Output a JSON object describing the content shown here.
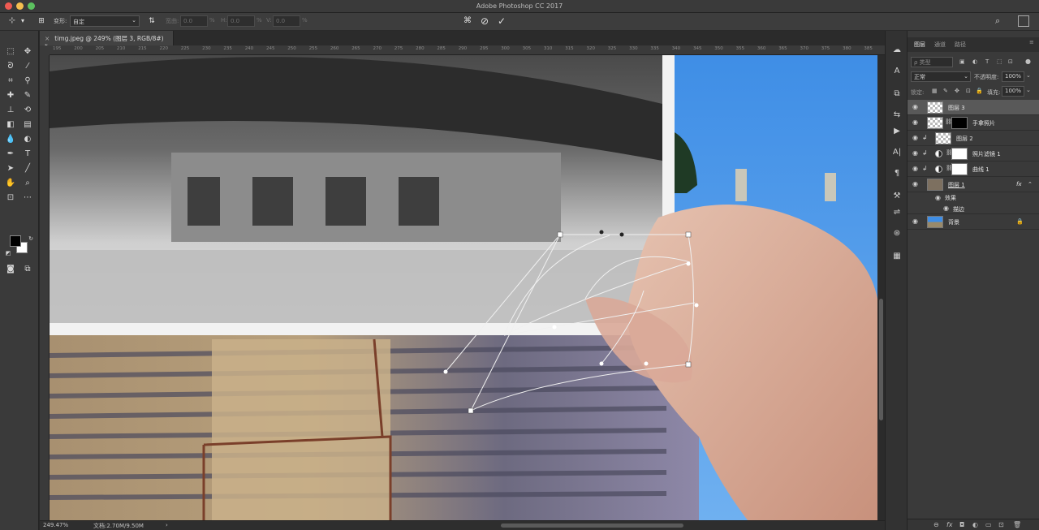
{
  "window": {
    "title": "Adobe Photoshop CC 2017"
  },
  "options": {
    "transform_label": "变形:",
    "transform_value": "自定",
    "w_label": "宽曲:",
    "w_value": "0.0",
    "h_label": "H:",
    "h_value": "0.0",
    "v_label": "V:",
    "v_value": "0.0",
    "percent": "%"
  },
  "document": {
    "tab_label": "timg.jpeg @ 249% (图层 3, RGB/8#) *",
    "ruler_ticks": [
      "195",
      "200",
      "205",
      "210",
      "215",
      "220",
      "225",
      "230",
      "235",
      "240",
      "245",
      "250",
      "255",
      "260",
      "265",
      "270",
      "275",
      "280",
      "285",
      "290",
      "295",
      "300",
      "305",
      "310",
      "315",
      "320",
      "325",
      "330",
      "335",
      "340",
      "345",
      "350",
      "355",
      "360",
      "365",
      "370",
      "375",
      "380",
      "385"
    ]
  },
  "status": {
    "zoom": "249.47%",
    "doc": "文档:2.70M/9.50M",
    "arrow": "›"
  },
  "layers_panel": {
    "tabs": [
      "图层",
      "通道",
      "路径"
    ],
    "filter_placeholder": "ρ 类型",
    "blend_mode": "正常",
    "opacity_label": "不透明度:",
    "opacity_value": "100%",
    "lock_label": "锁定:",
    "fill_label": "填充:",
    "fill_value": "100%",
    "layers": [
      {
        "name": "图层 3"
      },
      {
        "name": "手拿照片"
      },
      {
        "name": "图层 2"
      },
      {
        "name": "照片滤镜 1"
      },
      {
        "name": "曲线 1"
      },
      {
        "name": "图层 1",
        "fx": "fx"
      },
      {
        "name": "效果"
      },
      {
        "name": "描边"
      },
      {
        "name": "背景"
      }
    ],
    "footer_icons": [
      "⊖",
      "fx",
      "◘",
      "◐",
      "▭",
      "⊡",
      "🗑"
    ]
  }
}
